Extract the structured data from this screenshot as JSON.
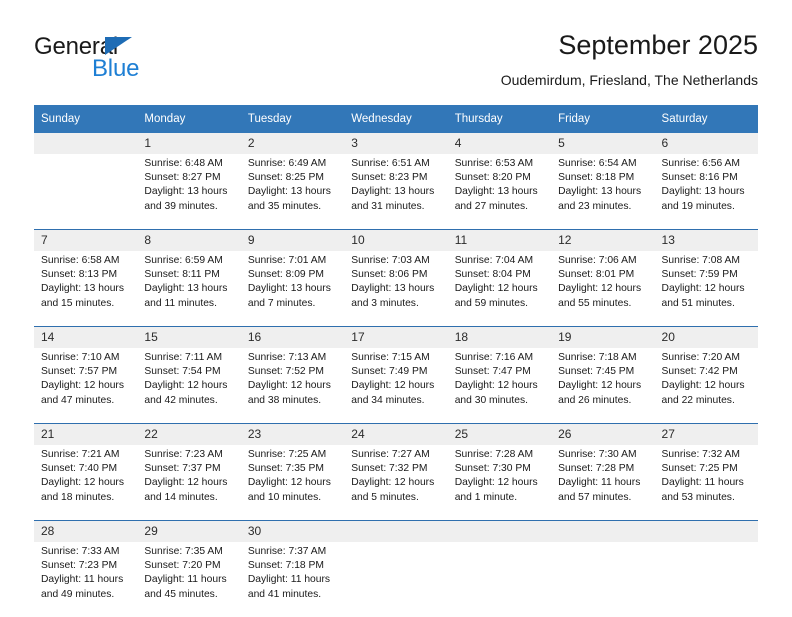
{
  "brand": {
    "name_part1": "General",
    "name_part2": "Blue",
    "accent_color": "#1e7fd4",
    "triangle_color": "#1e6cb5"
  },
  "header": {
    "title": "September 2025",
    "subtitle": "Oudemirdum, Friesland, The Netherlands"
  },
  "calendar": {
    "header_bg": "#3277b8",
    "daynum_bg": "#efefef",
    "separator_color": "#2f6fae",
    "weekdays": [
      "Sunday",
      "Monday",
      "Tuesday",
      "Wednesday",
      "Thursday",
      "Friday",
      "Saturday"
    ],
    "weeks": [
      {
        "days": [
          {
            "num": "",
            "sunrise": "",
            "sunset": "",
            "daylight_line1": "",
            "daylight_line2": ""
          },
          {
            "num": "1",
            "sunrise": "Sunrise: 6:48 AM",
            "sunset": "Sunset: 8:27 PM",
            "daylight_line1": "Daylight: 13 hours",
            "daylight_line2": "and 39 minutes."
          },
          {
            "num": "2",
            "sunrise": "Sunrise: 6:49 AM",
            "sunset": "Sunset: 8:25 PM",
            "daylight_line1": "Daylight: 13 hours",
            "daylight_line2": "and 35 minutes."
          },
          {
            "num": "3",
            "sunrise": "Sunrise: 6:51 AM",
            "sunset": "Sunset: 8:23 PM",
            "daylight_line1": "Daylight: 13 hours",
            "daylight_line2": "and 31 minutes."
          },
          {
            "num": "4",
            "sunrise": "Sunrise: 6:53 AM",
            "sunset": "Sunset: 8:20 PM",
            "daylight_line1": "Daylight: 13 hours",
            "daylight_line2": "and 27 minutes."
          },
          {
            "num": "5",
            "sunrise": "Sunrise: 6:54 AM",
            "sunset": "Sunset: 8:18 PM",
            "daylight_line1": "Daylight: 13 hours",
            "daylight_line2": "and 23 minutes."
          },
          {
            "num": "6",
            "sunrise": "Sunrise: 6:56 AM",
            "sunset": "Sunset: 8:16 PM",
            "daylight_line1": "Daylight: 13 hours",
            "daylight_line2": "and 19 minutes."
          }
        ]
      },
      {
        "days": [
          {
            "num": "7",
            "sunrise": "Sunrise: 6:58 AM",
            "sunset": "Sunset: 8:13 PM",
            "daylight_line1": "Daylight: 13 hours",
            "daylight_line2": "and 15 minutes."
          },
          {
            "num": "8",
            "sunrise": "Sunrise: 6:59 AM",
            "sunset": "Sunset: 8:11 PM",
            "daylight_line1": "Daylight: 13 hours",
            "daylight_line2": "and 11 minutes."
          },
          {
            "num": "9",
            "sunrise": "Sunrise: 7:01 AM",
            "sunset": "Sunset: 8:09 PM",
            "daylight_line1": "Daylight: 13 hours",
            "daylight_line2": "and 7 minutes."
          },
          {
            "num": "10",
            "sunrise": "Sunrise: 7:03 AM",
            "sunset": "Sunset: 8:06 PM",
            "daylight_line1": "Daylight: 13 hours",
            "daylight_line2": "and 3 minutes."
          },
          {
            "num": "11",
            "sunrise": "Sunrise: 7:04 AM",
            "sunset": "Sunset: 8:04 PM",
            "daylight_line1": "Daylight: 12 hours",
            "daylight_line2": "and 59 minutes."
          },
          {
            "num": "12",
            "sunrise": "Sunrise: 7:06 AM",
            "sunset": "Sunset: 8:01 PM",
            "daylight_line1": "Daylight: 12 hours",
            "daylight_line2": "and 55 minutes."
          },
          {
            "num": "13",
            "sunrise": "Sunrise: 7:08 AM",
            "sunset": "Sunset: 7:59 PM",
            "daylight_line1": "Daylight: 12 hours",
            "daylight_line2": "and 51 minutes."
          }
        ]
      },
      {
        "days": [
          {
            "num": "14",
            "sunrise": "Sunrise: 7:10 AM",
            "sunset": "Sunset: 7:57 PM",
            "daylight_line1": "Daylight: 12 hours",
            "daylight_line2": "and 47 minutes."
          },
          {
            "num": "15",
            "sunrise": "Sunrise: 7:11 AM",
            "sunset": "Sunset: 7:54 PM",
            "daylight_line1": "Daylight: 12 hours",
            "daylight_line2": "and 42 minutes."
          },
          {
            "num": "16",
            "sunrise": "Sunrise: 7:13 AM",
            "sunset": "Sunset: 7:52 PM",
            "daylight_line1": "Daylight: 12 hours",
            "daylight_line2": "and 38 minutes."
          },
          {
            "num": "17",
            "sunrise": "Sunrise: 7:15 AM",
            "sunset": "Sunset: 7:49 PM",
            "daylight_line1": "Daylight: 12 hours",
            "daylight_line2": "and 34 minutes."
          },
          {
            "num": "18",
            "sunrise": "Sunrise: 7:16 AM",
            "sunset": "Sunset: 7:47 PM",
            "daylight_line1": "Daylight: 12 hours",
            "daylight_line2": "and 30 minutes."
          },
          {
            "num": "19",
            "sunrise": "Sunrise: 7:18 AM",
            "sunset": "Sunset: 7:45 PM",
            "daylight_line1": "Daylight: 12 hours",
            "daylight_line2": "and 26 minutes."
          },
          {
            "num": "20",
            "sunrise": "Sunrise: 7:20 AM",
            "sunset": "Sunset: 7:42 PM",
            "daylight_line1": "Daylight: 12 hours",
            "daylight_line2": "and 22 minutes."
          }
        ]
      },
      {
        "days": [
          {
            "num": "21",
            "sunrise": "Sunrise: 7:21 AM",
            "sunset": "Sunset: 7:40 PM",
            "daylight_line1": "Daylight: 12 hours",
            "daylight_line2": "and 18 minutes."
          },
          {
            "num": "22",
            "sunrise": "Sunrise: 7:23 AM",
            "sunset": "Sunset: 7:37 PM",
            "daylight_line1": "Daylight: 12 hours",
            "daylight_line2": "and 14 minutes."
          },
          {
            "num": "23",
            "sunrise": "Sunrise: 7:25 AM",
            "sunset": "Sunset: 7:35 PM",
            "daylight_line1": "Daylight: 12 hours",
            "daylight_line2": "and 10 minutes."
          },
          {
            "num": "24",
            "sunrise": "Sunrise: 7:27 AM",
            "sunset": "Sunset: 7:32 PM",
            "daylight_line1": "Daylight: 12 hours",
            "daylight_line2": "and 5 minutes."
          },
          {
            "num": "25",
            "sunrise": "Sunrise: 7:28 AM",
            "sunset": "Sunset: 7:30 PM",
            "daylight_line1": "Daylight: 12 hours",
            "daylight_line2": "and 1 minute."
          },
          {
            "num": "26",
            "sunrise": "Sunrise: 7:30 AM",
            "sunset": "Sunset: 7:28 PM",
            "daylight_line1": "Daylight: 11 hours",
            "daylight_line2": "and 57 minutes."
          },
          {
            "num": "27",
            "sunrise": "Sunrise: 7:32 AM",
            "sunset": "Sunset: 7:25 PM",
            "daylight_line1": "Daylight: 11 hours",
            "daylight_line2": "and 53 minutes."
          }
        ]
      },
      {
        "days": [
          {
            "num": "28",
            "sunrise": "Sunrise: 7:33 AM",
            "sunset": "Sunset: 7:23 PM",
            "daylight_line1": "Daylight: 11 hours",
            "daylight_line2": "and 49 minutes."
          },
          {
            "num": "29",
            "sunrise": "Sunrise: 7:35 AM",
            "sunset": "Sunset: 7:20 PM",
            "daylight_line1": "Daylight: 11 hours",
            "daylight_line2": "and 45 minutes."
          },
          {
            "num": "30",
            "sunrise": "Sunrise: 7:37 AM",
            "sunset": "Sunset: 7:18 PM",
            "daylight_line1": "Daylight: 11 hours",
            "daylight_line2": "and 41 minutes."
          },
          {
            "num": "",
            "sunrise": "",
            "sunset": "",
            "daylight_line1": "",
            "daylight_line2": ""
          },
          {
            "num": "",
            "sunrise": "",
            "sunset": "",
            "daylight_line1": "",
            "daylight_line2": ""
          },
          {
            "num": "",
            "sunrise": "",
            "sunset": "",
            "daylight_line1": "",
            "daylight_line2": ""
          },
          {
            "num": "",
            "sunrise": "",
            "sunset": "",
            "daylight_line1": "",
            "daylight_line2": ""
          }
        ]
      }
    ]
  }
}
